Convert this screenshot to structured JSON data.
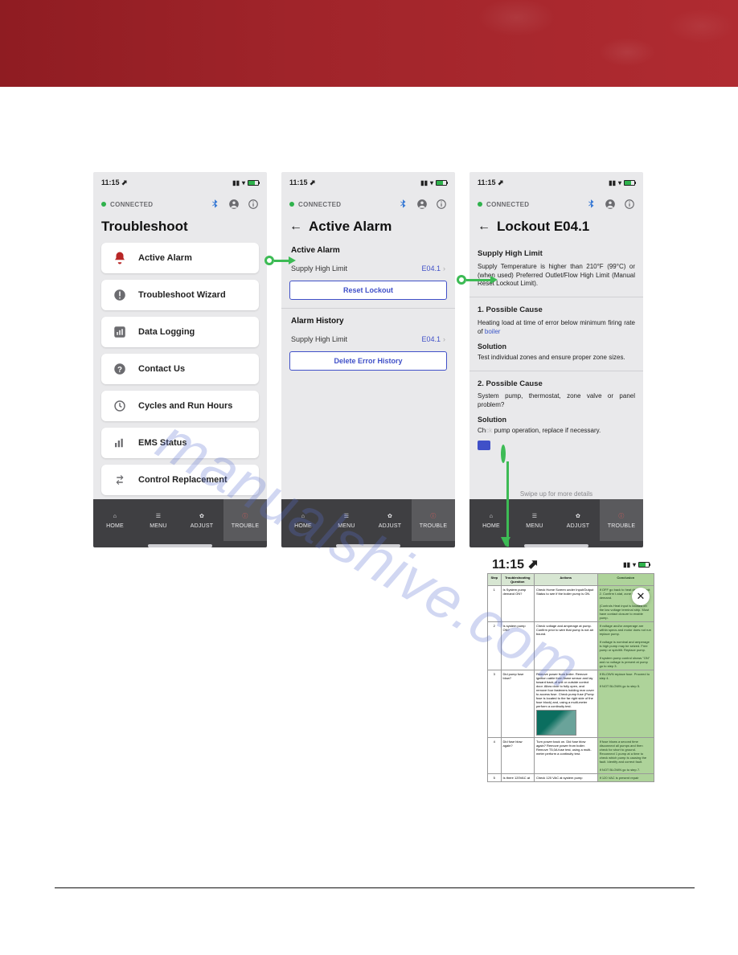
{
  "watermark": "manualshive.com",
  "status": {
    "time": "11:15 ⬈"
  },
  "connection": {
    "label": "CONNECTED"
  },
  "tabs": {
    "home": "HOME",
    "menu": "MENU",
    "adjust": "ADJUST",
    "trouble": "TROUBLE"
  },
  "phone1": {
    "title": "Troubleshoot",
    "items": [
      "Active Alarm",
      "Troubleshoot Wizard",
      "Data Logging",
      "Contact Us",
      "Cycles and Run Hours",
      "EMS Status",
      "Control Replacement"
    ]
  },
  "phone2": {
    "title": "Active Alarm",
    "section_active": "Active Alarm",
    "row_active": {
      "name": "Supply High Limit",
      "code": "E04.1"
    },
    "btn_reset": "Reset Lockout",
    "section_history": "Alarm History",
    "row_history": {
      "name": "Supply High Limit",
      "code": "E04.1"
    },
    "btn_delete": "Delete Error History"
  },
  "phone3": {
    "title": "Lockout E04.1",
    "h_supply": "Supply High Limit",
    "p_supply": "Supply Temperature is higher than 210°F (99°C) or (when used) Preferred Outlet/Flow High Limit (Manual Reset Lockout Limit).",
    "h_c1": "1. Possible Cause",
    "p_c1": "Heating load at time of error below minimum firing rate of ",
    "p_c1_link": "boiler",
    "h_s1": "Solution",
    "p_s1": "Test individual zones and ensure proper zone sizes.",
    "h_c2": "2. Possible Cause",
    "p_c2": "System pump, thermostat, zone valve or panel problem?",
    "h_s2": "Solution",
    "p_s2_a": "Ch",
    "p_s2_b": "ck",
    "p_s2_c": " pump operation, replace if necessary.",
    "swipe": "Swipe up for more details"
  },
  "phone4": {
    "headers": {
      "step": "Step",
      "q": "Troubleshooting Question",
      "a": "Actions",
      "c": "Conclusion"
    },
    "rows": [
      {
        "n": "1",
        "q": "Is System pump demand ON?",
        "a": "Check Home Screen under Input/Output Status to see if the boiler pump is ON.",
        "c": "If OFF go back to heat demand unit 2. Confirm t-stat, zone control heat demand.\n\n(Controls Heat input is located on the low voltage terminal strip. Must have contact closure to enable pump."
      },
      {
        "n": "2",
        "q": "Is system pump ON?",
        "a": "Check voltage and amperage at pump. Confirm prior to wire that pump is not air bound.",
        "c": "If voltage and/or amperage are within specs and motor does not run replace pump.\n\nIf voltage is nominal and amperage is high pump may be seized. Free pump or spin/tilt. Replace pump.\n\nIf system pump control shows \"ON\" and no voltage is present at pump go to step 3."
      },
      {
        "n": "3",
        "q": "Did pump fuse blow?",
        "a": "Remove power from boiler. Remove ignition cable from flame sensor and lay toward back of unit or outside control door. Allow door to fully open, and remove four fasteners holding rear cover to access fuse. Check pump fuse (Pump fuse is located to the far right side of the fuse block) and, using a multi-meter perform a continuity test.",
        "c": "If BLOWN replace fuse. Proceed to step 4.\n\nIf NOT BLOWN go to step 5."
      },
      {
        "n": "4",
        "q": "Did fuse blow again?",
        "a": "Turn power back on. Did fuse blow again? Remove power from boiler. Remove T5,0A fuse test, using a multi-meter perform a continuity test.",
        "c": "If fuse blows a second time disconnect all pumps and then check for short to ground. Reconnect 1 pump at a time to check which pump is causing the fault. Identify and correct fault.\n\nIf NOT BLOWN go to step 7."
      },
      {
        "n": "5",
        "q": "Is there 120VAC at",
        "a": "Check 120 VAC at system pump",
        "c": "If 120 VAC is present repair"
      }
    ]
  }
}
